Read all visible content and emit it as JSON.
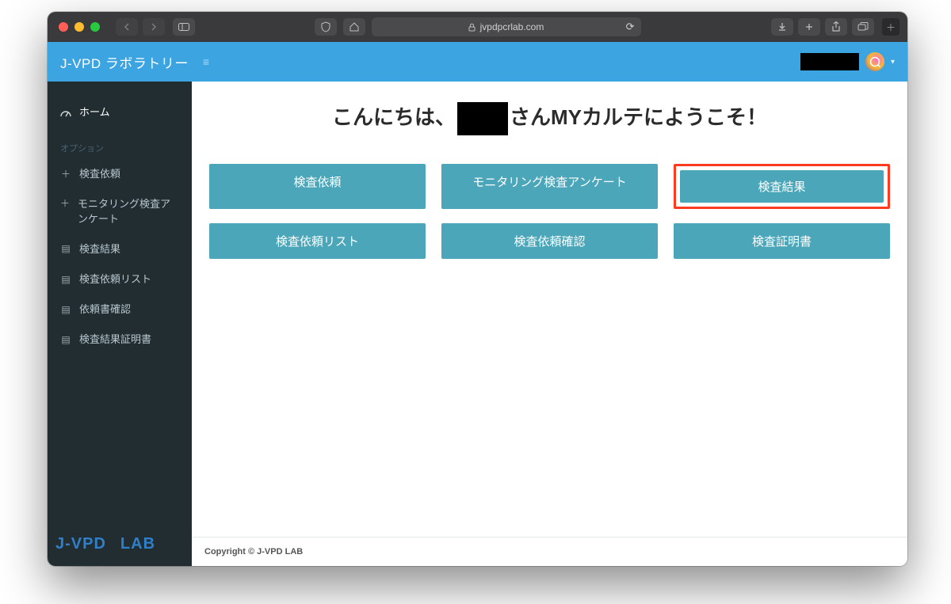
{
  "browser": {
    "url_host": "jvpdpcrlab.com"
  },
  "header": {
    "title": "J-VPD ラボラトリー"
  },
  "sidebar": {
    "home": "ホーム",
    "caption": "オプション",
    "items": [
      {
        "icon": "＋",
        "label": "検査依頼"
      },
      {
        "icon": "＋",
        "label": "モニタリング検査アンケート"
      },
      {
        "icon": "▤",
        "label": "検査結果"
      },
      {
        "icon": "▤",
        "label": "検査依頼リスト"
      },
      {
        "icon": "▤",
        "label": "依頼書確認"
      },
      {
        "icon": "▤",
        "label": "検査結果証明書"
      }
    ],
    "logo_a": "J-VPD",
    "logo_b": "LAB"
  },
  "main": {
    "greet_a": "こんにちは、",
    "greet_b": "さんMYカルテにようこそ！",
    "buttons": [
      "検査依頼",
      "モニタリング検査アンケート",
      "検査結果",
      "検査依頼リスト",
      "検査依頼確認",
      "検査証明書"
    ],
    "highlight_index": 2
  },
  "footer": {
    "text": "Copyright © J-VPD LAB"
  }
}
